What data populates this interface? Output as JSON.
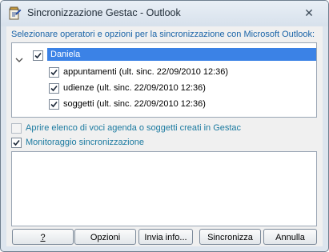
{
  "window": {
    "title": "Sincronizzazione Gestac - Outlook"
  },
  "instruction": "Selezionare operatori e opzioni per la sincronizzazione con Microsoft Outlook:",
  "tree": {
    "operator": {
      "label": "Daniela",
      "checked": true,
      "expanded": true
    },
    "items": [
      {
        "label": "appuntamenti (ult. sinc. 22/09/2010 12:36)",
        "checked": true
      },
      {
        "label": "udienze (ult. sinc. 22/09/2010 12:36)",
        "checked": true
      },
      {
        "label": "soggetti (ult. sinc. 22/09/2010 12:36)",
        "checked": true
      }
    ]
  },
  "options": [
    {
      "label": "Aprire elenco di voci agenda o soggetti creati in Gestac",
      "checked": false,
      "enabled": false
    },
    {
      "label": "Monitoraggio sincronizzazione",
      "checked": true,
      "enabled": true
    }
  ],
  "buttons": {
    "help": "?",
    "options": "Opzioni",
    "send_info": "Invia info...",
    "sync": "Sincronizza",
    "cancel": "Annulla"
  },
  "colors": {
    "selection": "#3b82e6",
    "accent_text": "#1a64a8",
    "option_text": "#1b7aa0"
  },
  "icons": {
    "app": "gestac-app-icon",
    "close": "close-icon"
  }
}
